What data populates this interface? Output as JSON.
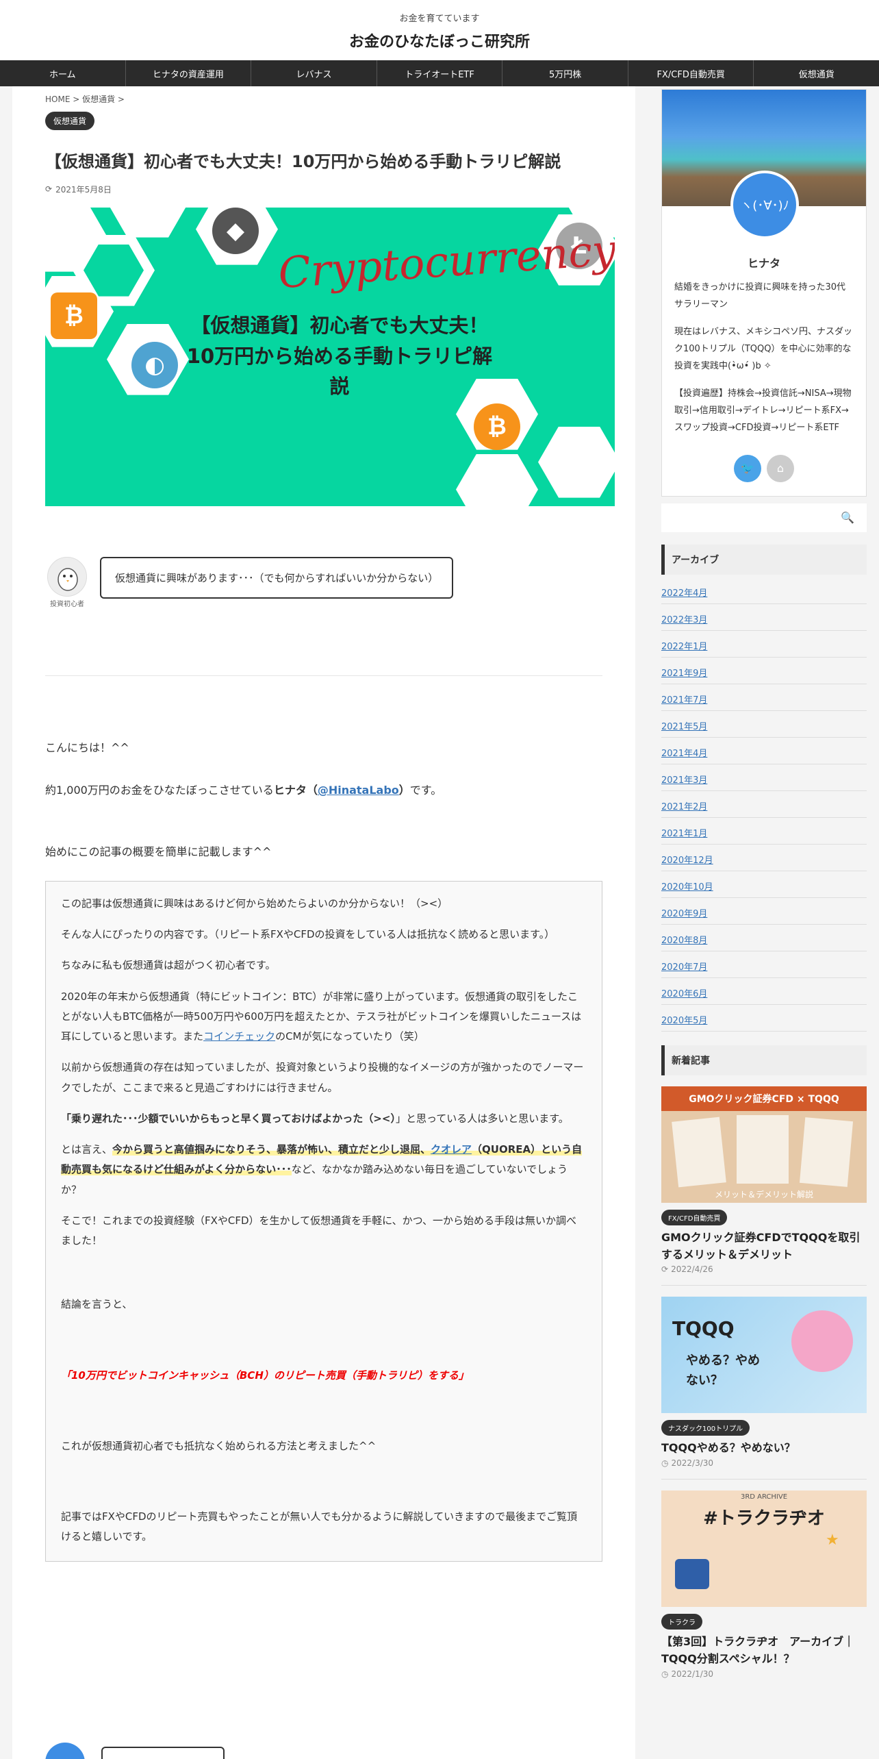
{
  "header": {
    "tagline": "お金を育てています",
    "site_title": "お金のひなたぼっこ研究所"
  },
  "nav": [
    "ホーム",
    "ヒナタの資産運用",
    "レバナス",
    "トライオートETF",
    "5万円株",
    "FX/CFD自動売買",
    "仮想通貨"
  ],
  "breadcrumb": "HOME > 仮想通貨 >",
  "article": {
    "category": "仮想通貨",
    "title": "【仮想通貨】初心者でも大丈夫！10万円から始める手動トラリピ解説",
    "date": "2021年5月8日",
    "eyecatch": {
      "script": "Cryptocurrency",
      "line1": "【仮想通貨】初心者でも大丈夫！",
      "line2": "10万円から始める手動トラリピ解説"
    },
    "speech": {
      "avatar_label": "投資初心者",
      "text": "仮想通貨に興味があります･･･（でも何からすればいいか分からない）"
    },
    "hello": "こんにちは！^^",
    "intro_prefix": "約1,000万円のお金をひなたぼっこさせている",
    "intro_name": "ヒナタ（",
    "intro_link": "@HinataLabo",
    "intro_name_close": "）",
    "intro_suffix": "です。",
    "summary_lead": "始めにこの記事の概要を簡単に記載します^^",
    "box": {
      "p1": "この記事は仮想通貨に興味はあるけど何から始めたらよいのか分からない！（><）",
      "p2": "そんな人にぴったりの内容です。（リピート系FXやCFDの投資をしている人は抵抗なく読めると思います。）",
      "p3": "ちなみに私も仮想通貨は超がつく初心者です。",
      "p4a": "2020年の年末から仮想通貨（特にビットコイン：BTC）が非常に盛り上がっています。仮想通貨の取引をしたことがない人もBTC価格が一時500万円や600万円を超えたとか、テスラ社がビットコインを爆買いしたニュースは耳にしていると思います。また",
      "p4link": "コインチェック",
      "p4b": "のCMが気になっていたり（笑）",
      "p5": "以前から仮想通貨の存在は知っていましたが、投資対象というより投機的なイメージの方が強かったのでノーマークでしたが、ここまで来ると見過ごすわけには行きません。",
      "p6bold": "「乗り遅れた･･･少額でいいからもっと早く買っておけばよかった（><）",
      "p6rest": "」と思っている人は多いと思います。",
      "p7a": "とは言え、",
      "p7mark1": "今から買うと高値掴みになりそう、暴落が怖い、積立だと少し退屈、",
      "p7link": "クオレア",
      "p7mark2": "（QUOREA）という自動売買も気になるけど仕組みがよく分からない･･･",
      "p7b": "など、なかなか踏み込めない毎日を過ごしていないでしょうか？",
      "p8": "そこで！これまでの投資経験（FXやCFD）を生かして仮想通貨を手軽に、かつ、一から始める手段は無いか調べました！",
      "p9": "結論を言うと、",
      "p10": "「10万円でビットコインキャッシュ（BCH）のリピート売買（手動トラリピ）をする」",
      "p11": "これが仮想通貨初心者でも抵抗なく始められる方法と考えました^^",
      "p12": "記事ではFXやCFDのリピート売買もやったことが無い人でも分かるように解説していきますので最後までご覧頂けると嬉しいです。"
    }
  },
  "sidebar": {
    "profile": {
      "avatar_text": "ヽ(･∀･)ﾉ",
      "name": "ヒナタ",
      "desc1": "結婚をきっかけに投資に興味を持った30代サラリーマン",
      "desc2": "現在はレバナス、メキシコペソ円、ナスダック100トリプル（TQQQ）を中心に効率的な投資を実践中(•̀ω•́ )b ✧",
      "desc3": "【投資遍歴】持株会→投資信託→NISA→現物取引→信用取引→デイトレ→リピート系FX→スワップ投資→CFD投資→リピート系ETF"
    },
    "archive_title": "アーカイブ",
    "archives": [
      "2022年4月",
      "2022年3月",
      "2022年1月",
      "2021年9月",
      "2021年7月",
      "2021年5月",
      "2021年4月",
      "2021年3月",
      "2021年2月",
      "2021年1月",
      "2020年12月",
      "2020年10月",
      "2020年9月",
      "2020年8月",
      "2020年7月",
      "2020年6月",
      "2020年5月"
    ],
    "new_title": "新着記事",
    "new_posts": [
      {
        "thumb_text": "GMOクリック証券CFD × TQQQ",
        "thumb_sub": "メリット＆デメリット解説",
        "category": "FX/CFD自動売買",
        "title": "GMOクリック証券CFDでTQQQを取引するメリット＆デメリット",
        "date": "2022/4/26"
      },
      {
        "thumb_text": "TQQQ",
        "thumb_sub": "やめる？やめない？",
        "category": "ナスダック100トリプル",
        "title": "TQQQやめる？やめない？",
        "date": "2022/3/30"
      },
      {
        "thumb_text": "#トラクラヂオ",
        "thumb_sub": "3RD ARCHIVE",
        "category": "トラクラ",
        "title": "【第3回】トラクラヂオ　アーカイブ｜TQQQ分割スペシャル！？",
        "date": "2022/1/30"
      }
    ]
  }
}
